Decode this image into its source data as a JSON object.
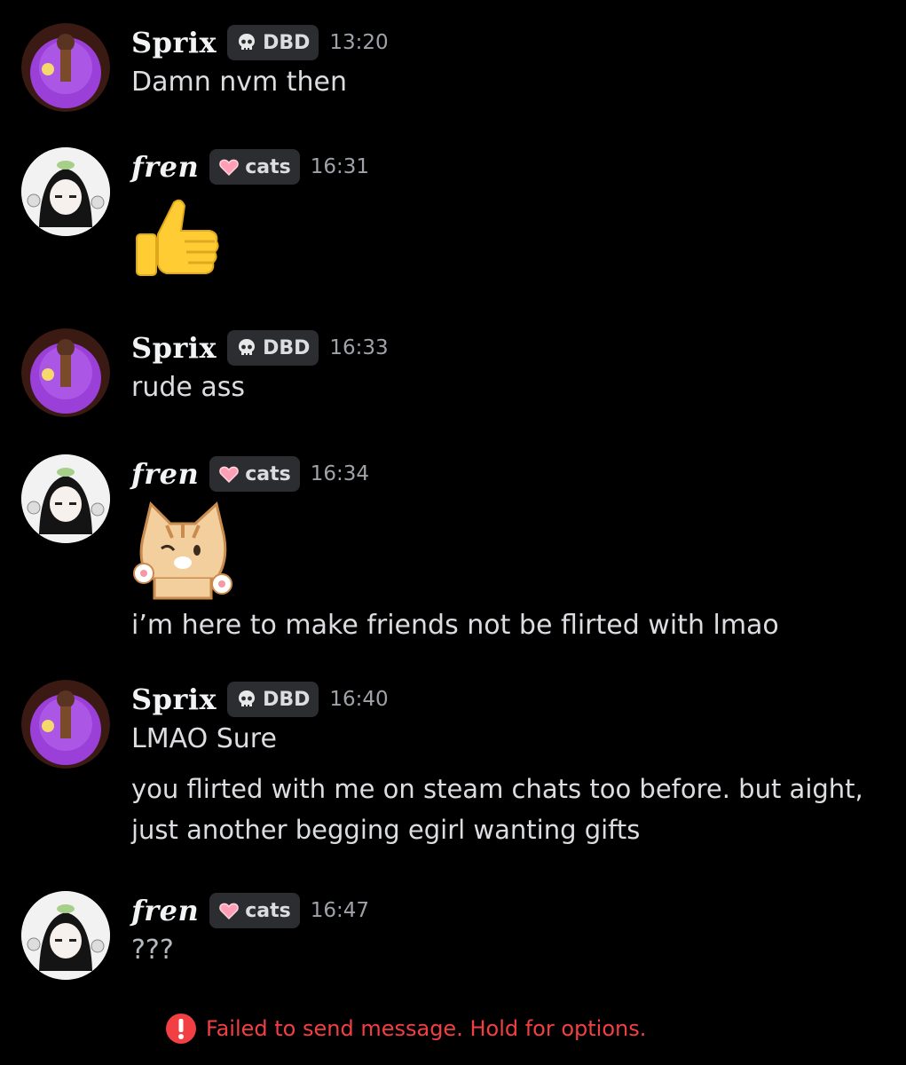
{
  "messages": [
    {
      "author": "Sprix",
      "tag": "DBD",
      "time": "13:20",
      "lines": [
        "Damn nvm then"
      ]
    },
    {
      "author": "fren",
      "tag": "cats",
      "time": "16:31",
      "content": "thumbs-up emoji"
    },
    {
      "author": "Sprix",
      "tag": "DBD",
      "time": "16:33",
      "lines": [
        "rude ass"
      ]
    },
    {
      "author": "fren",
      "tag": "cats",
      "time": "16:34",
      "sticker": "cat sticker",
      "lines": [
        "i’m here to make friends not be flirted with lmao"
      ]
    },
    {
      "author": "Sprix",
      "tag": "DBD",
      "time": "16:40",
      "lines": [
        "LMAO Sure",
        "you flirted with me on steam chats too before. but aight,",
        "just another begging egirl wanting gifts"
      ]
    },
    {
      "author": "fren",
      "tag": "cats",
      "time": "16:47",
      "lines": [
        "???"
      ]
    }
  ],
  "error": {
    "text": "Failed to send message. Hold for options."
  },
  "icons": {
    "dbd_tag": "skull-icon",
    "cats_tag": "heart-icon",
    "error": "exclamation-icon",
    "emoji": "thumbs-up-icon",
    "sticker": "cat-sticker-icon"
  },
  "colors": {
    "background": "#000000",
    "error": "#f23f43",
    "accent_purple": "#a855f7"
  }
}
